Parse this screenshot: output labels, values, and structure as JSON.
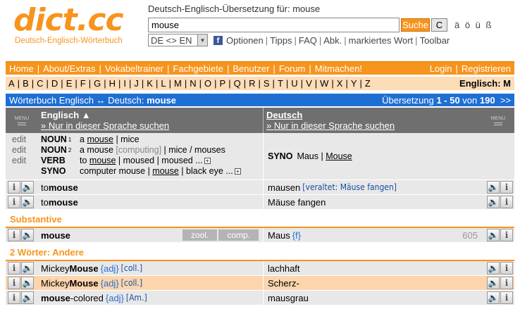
{
  "logo": {
    "text": "dict.cc",
    "subtitle": "Deutsch-Englisch-Wörterbuch"
  },
  "site_title": "Deutsch-Englisch-Übersetzung für: mouse",
  "search": {
    "value": "mouse",
    "button": "Suche",
    "clear": "C",
    "umlauts": "ä ö ü ß"
  },
  "options": {
    "lang_select": "DE <> EN",
    "links": [
      "Optionen",
      "Tipps",
      "FAQ",
      "Abk.",
      "markiertes Wort",
      "Toolbar"
    ]
  },
  "nav": {
    "left": [
      "Home",
      "About/Extras",
      "Vokabeltrainer",
      "Fachgebiete",
      "Benutzer",
      "Forum",
      "Mitmachen!"
    ],
    "right": [
      "Login",
      "Registrieren"
    ]
  },
  "alphabet": [
    "A",
    "B",
    "C",
    "D",
    "E",
    "F",
    "G",
    "H",
    "I",
    "J",
    "K",
    "L",
    "M",
    "N",
    "O",
    "P",
    "Q",
    "R",
    "S",
    "T",
    "U",
    "V",
    "W",
    "X",
    "Y",
    "Z"
  ],
  "alphabet_current": "Englisch: M",
  "result_bar": {
    "left_prefix": "Wörterbuch Englisch ↔ Deutsch: ",
    "left_term": "mouse",
    "right_prefix": "Übersetzung ",
    "range": "1 - 50",
    "of_text": " von ",
    "total": "190",
    "next": ">>"
  },
  "table_header": {
    "menu": "MENU",
    "en_title": "Englisch ▲",
    "de_title": "Deutsch",
    "search_in_lang": "» Nur in dieser Sprache suchen"
  },
  "synonyms": {
    "edit_links": [
      "edit",
      "edit",
      "edit"
    ],
    "en": [
      {
        "pos": "NOUN",
        "sup": "1",
        "text": [
          [
            "a ",
            "n"
          ],
          [
            "mouse",
            "u"
          ],
          [
            " | mice",
            "n"
          ]
        ]
      },
      {
        "pos": "NOUN",
        "sup": "2",
        "text": [
          [
            "a mouse ",
            "n"
          ],
          [
            "[computing]",
            "g"
          ],
          [
            " | mice / mouses",
            "n"
          ]
        ]
      },
      {
        "pos": "VERB",
        "sup": "",
        "text": [
          [
            "to ",
            "n"
          ],
          [
            "mouse",
            "u"
          ],
          [
            " | moused | moused ...",
            "n"
          ]
        ]
      },
      {
        "pos": "SYNO",
        "sup": "",
        "text": [
          [
            "computer mouse | ",
            "n"
          ],
          [
            "mouse",
            "u"
          ],
          [
            " | black eye ...",
            "n"
          ]
        ]
      }
    ],
    "de_label": "SYNO",
    "de_text": "Maus | ",
    "de_link": "Mouse"
  },
  "entries_top": [
    {
      "en_pre": "to ",
      "en_bold": "mouse",
      "de": "mausen",
      "de_extra": "[veraltet: Mäuse fangen]"
    },
    {
      "en_pre": "to ",
      "en_bold": "mouse",
      "de": "Mäuse fangen",
      "de_extra": ""
    }
  ],
  "section_substantive": "Substantive",
  "entry_noun": {
    "en_bold": "mouse",
    "tags": [
      "zool.",
      "comp."
    ],
    "de": "Maus",
    "de_gender": "{f}",
    "count": "605"
  },
  "section_two_words": "2 Wörter: Andere",
  "entries_two": [
    {
      "en_a": "Mickey ",
      "en_bold": "Mouse",
      "tag": "{adj}",
      "abbr": "[coll.]",
      "de": "lachhaft"
    },
    {
      "en_a": "Mickey ",
      "en_bold": "Mouse",
      "tag": "{adj}",
      "abbr": "[coll.]",
      "de": "Scherz-"
    },
    {
      "en_a": "",
      "en_bold": "mouse",
      "en_b": "-colored",
      "tag": "{adj}",
      "abbr": "[Am.]",
      "de": "mausgrau"
    }
  ],
  "icons": {
    "info": "i",
    "sound": "speaker-icon"
  },
  "colors": {
    "accent": "#f7941d",
    "result_bar": "#1e6fd4",
    "alpha_bg": "#fddcb8",
    "highlight_row": "#fcd5ad"
  }
}
